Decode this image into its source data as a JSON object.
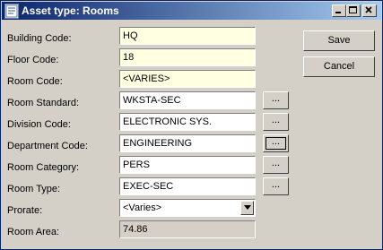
{
  "window": {
    "title": "Asset type: Rooms",
    "controls": [
      "minimize-icon",
      "maximize-icon",
      "close-icon"
    ]
  },
  "form": {
    "building_code": {
      "label": "Building Code:",
      "value": "HQ"
    },
    "floor_code": {
      "label": "Floor Code:",
      "value": "18"
    },
    "room_code": {
      "label": "Room Code:",
      "value": "<VARIES>"
    },
    "room_standard": {
      "label": "Room Standard:",
      "value": "WKSTA-SEC",
      "lookup": "..."
    },
    "division_code": {
      "label": "Division Code:",
      "value": "ELECTRONIC SYS.",
      "lookup": "..."
    },
    "department_code": {
      "label": "Department Code:",
      "value": "ENGINEERING",
      "lookup": "..."
    },
    "room_category": {
      "label": "Room Category:",
      "value": "PERS",
      "lookup": "..."
    },
    "room_type": {
      "label": "Room Type:",
      "value": "EXEC-SEC",
      "lookup": "..."
    },
    "prorate": {
      "label": "Prorate:",
      "value": "<Varies>"
    },
    "room_area": {
      "label": "Room Area:",
      "value": "74.86"
    }
  },
  "buttons": {
    "save": "Save",
    "cancel": "Cancel"
  },
  "colors": {
    "titlebar_start": "#0a246a",
    "titlebar_end": "#a6caf0",
    "required_field_bg": "#ffffe1",
    "dialog_bg": "#d4d0c8"
  }
}
